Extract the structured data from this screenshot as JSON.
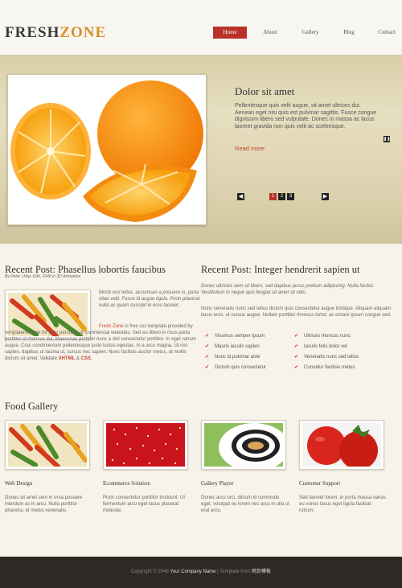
{
  "header": {
    "logo_part1": "FRESH",
    "logo_part2": "ZONE",
    "nav": [
      "Home",
      "About",
      "Gallery",
      "Blog",
      "Contact"
    ]
  },
  "slider": {
    "title": "Dolor sit amet",
    "text": "Pellentesque quis velit augue, sit amet ultrices dui. Aenean eget nisi quis est pulvinar sagittis. Fusce congue dignissim libero sed vulputate. Donec in massa ac lacus laoreet gravida non quis velit ac scelerisque.",
    "read_more": "Read more",
    "pages": [
      "1",
      "2",
      "3"
    ]
  },
  "post1": {
    "title": "Recent Post: Phasellus lobortis faucibus",
    "meta": "By Peter | May 16th, 2048 in 3D Animation",
    "intro": "Morbi orci tellus, accumsan a posuere in, porta vitae velit. Fusce id augue ligula. Proin placerat nulla ac quam suscipit in eros laoreet.",
    "brand": "Fresh Zone",
    "para_after_brand": " is free css template provided by templatemo.com for your personal or commercial websites. Sed eu libero in risus porta porttitor id rhoncus dui. Maecenas porttitor nunc a nisl consectetur porttitor. In eget rutrum augue. Cras condimentum pellentesque justo luctus egestas. In a arcu magna. Ut nisi sapien, dapibus ut lacinia ut, cursus nec sapien. Nunc facilisis auctor metus, at mollis dictum sit amet. Validate ",
    "xhtml": "XHTML",
    "amp": " & ",
    "css": "CSS",
    "end": "."
  },
  "post2": {
    "title": "Recent Post: Integer hendrerit sapien ut",
    "intro": "Donec ultricies sem sit libero, sed dapibus purus pretium adipiscing. Nulla facilisi. Vestibulum in neque quis feugiat sit amet sit odio.",
    "para": "Nunc venenatis nunc sed tellus dictum quis consectetur augue tristique. Aliquam aliquam lacus eros, ut cursus augue. Nullam porttitor rhoncus tortor, ac ornare ipsum congue sed.",
    "list_left": [
      "Vivamus semper ipsum",
      "Mauris iaculis sapien",
      "Nunc id pulvinar ante",
      "Dictum quis consectetur"
    ],
    "list_right": [
      "Ultrices rhoncus nunc",
      "Iaculis felis dolor vel",
      "Venenatis nunc sed tellus",
      "Cursuitur facilisis metus"
    ]
  },
  "gallery": {
    "title": "Food Gallery",
    "items": [
      {
        "caption": "Web Design",
        "text": "Donec sit amet sem in urna posuere interdum ac in arcu. Nulla porttitor pharetra, et metus venenatis."
      },
      {
        "caption": "Ecommerce Solution",
        "text": "Proin consectetur porttitor tincidunt. Ut fermentum arcu eget lacus placerat molestie."
      },
      {
        "caption": "Gallery Player",
        "text": "Donec arcu orci, dictum id commodo eget, volutpat eu lorem nec arcu in ulla ut erat arcu."
      },
      {
        "caption": "Customer Support",
        "text": "Sed laoreet lorem, in porta massa varius eu vorius lacus eget ligula facilisis rutrum."
      }
    ]
  },
  "footer": {
    "copyright": "Copyright © 2048 ",
    "company": "Your Company Name",
    "sep": " | Template from ",
    "credit": "网页模板"
  },
  "colors": {
    "accent": "#b8322a",
    "logo_accent": "#d8902a",
    "footer_bg": "#2d2a26"
  }
}
